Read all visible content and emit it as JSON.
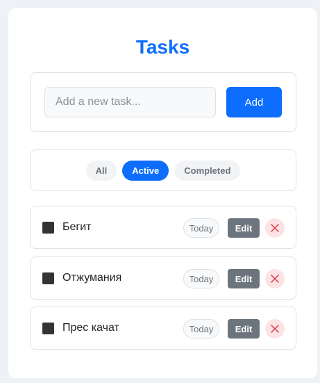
{
  "app": {
    "title": "Tasks"
  },
  "add_form": {
    "placeholder": "Add a new task...",
    "add_label": "Add"
  },
  "filters": [
    {
      "label": "All",
      "active": false
    },
    {
      "label": "Active",
      "active": true
    },
    {
      "label": "Completed",
      "active": false
    }
  ],
  "tasks": [
    {
      "name": "Бегит",
      "date": "Today",
      "edit_label": "Edit",
      "done": false
    },
    {
      "name": "Отжумания",
      "date": "Today",
      "edit_label": "Edit",
      "done": false
    },
    {
      "name": "Прес качат",
      "date": "Today",
      "edit_label": "Edit",
      "done": false
    }
  ],
  "colors": {
    "accent": "#0d6efd",
    "delete_bg": "#fbe3e6",
    "delete_icon": "#dc3545"
  },
  "icons": {
    "delete": "close-icon",
    "checkbox": "checkbox-icon"
  }
}
